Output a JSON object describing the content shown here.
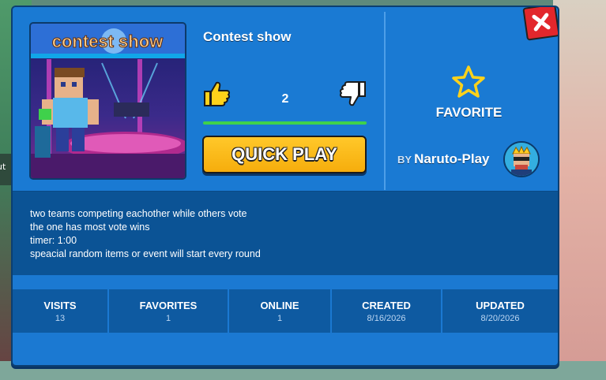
{
  "game": {
    "title": "Contest show",
    "thumbnail_text": "contest show",
    "votes": "2",
    "like_ratio": 1.0,
    "quick_play_label": "QUICK PLAY",
    "favorite_label": "FAVORITE",
    "author_prefix": "BY",
    "author_name": "Naruto-Play"
  },
  "description": {
    "lines": [
      "two teams competing eachother  while others vote",
      "the one has most vote wins",
      "timer: 1:00",
      "speacial random items or event will start every round"
    ]
  },
  "stats": [
    {
      "label": "VISITS",
      "value": "13"
    },
    {
      "label": "FAVORITES",
      "value": "1"
    },
    {
      "label": "ONLINE",
      "value": "1"
    },
    {
      "label": "CREATED",
      "value": "8/16/2026"
    },
    {
      "label": "UPDATED",
      "value": "8/20/2026"
    }
  ],
  "background_peek": {
    "text": "ut"
  },
  "icons": {
    "like": "thumbs-up-icon",
    "dislike": "thumbs-down-icon",
    "favorite": "star-icon",
    "close": "close-icon"
  },
  "colors": {
    "panel": "#1b79d2",
    "description_bg": "#0b5395",
    "stats_bg": "#0e5aa1",
    "quick_play": "#f6ad0c",
    "rating_fill": "#3fd14b",
    "close_button": "#e2272c",
    "star": "#ffd21a"
  }
}
